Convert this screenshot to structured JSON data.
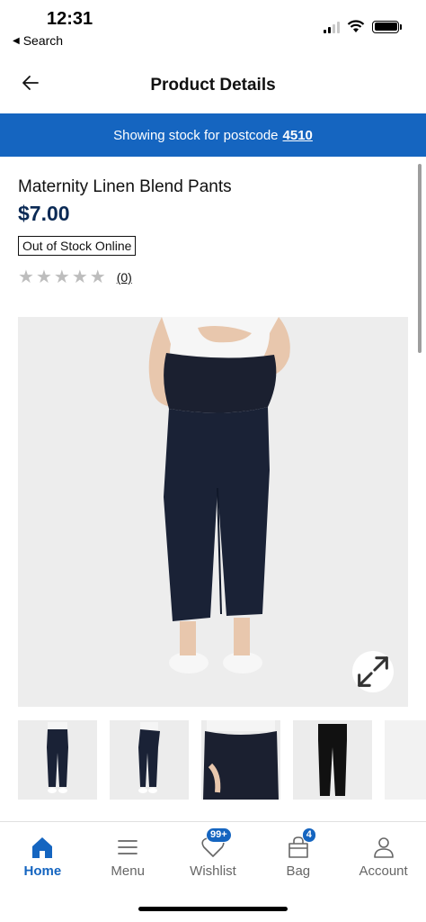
{
  "status_bar": {
    "time": "12:31",
    "back_label": "Search"
  },
  "header": {
    "title": "Product Details",
    "back_icon": "arrow-left-icon"
  },
  "banner": {
    "text": "Showing stock for postcode",
    "postcode": "4510",
    "color": "#1565c0"
  },
  "product": {
    "name": "Maternity Linen Blend Pants",
    "price": "$7.00",
    "stock_status": "Out of Stock Online",
    "rating_stars": 0,
    "review_count": "(0)",
    "price_color": "#0b2a55"
  },
  "gallery": {
    "expand_icon": "expand-icon",
    "thumbnails": [
      "front-view",
      "side-view",
      "bump-closeup",
      "flat-lay"
    ]
  },
  "bottom_nav": {
    "items": [
      {
        "label": "Home",
        "icon": "home-icon",
        "active": true
      },
      {
        "label": "Menu",
        "icon": "menu-icon",
        "active": false
      },
      {
        "label": "Wishlist",
        "icon": "heart-icon",
        "badge": "99+",
        "active": false
      },
      {
        "label": "Bag",
        "icon": "bag-icon",
        "badge": "4",
        "active": false
      },
      {
        "label": "Account",
        "icon": "account-icon",
        "active": false
      }
    ]
  }
}
